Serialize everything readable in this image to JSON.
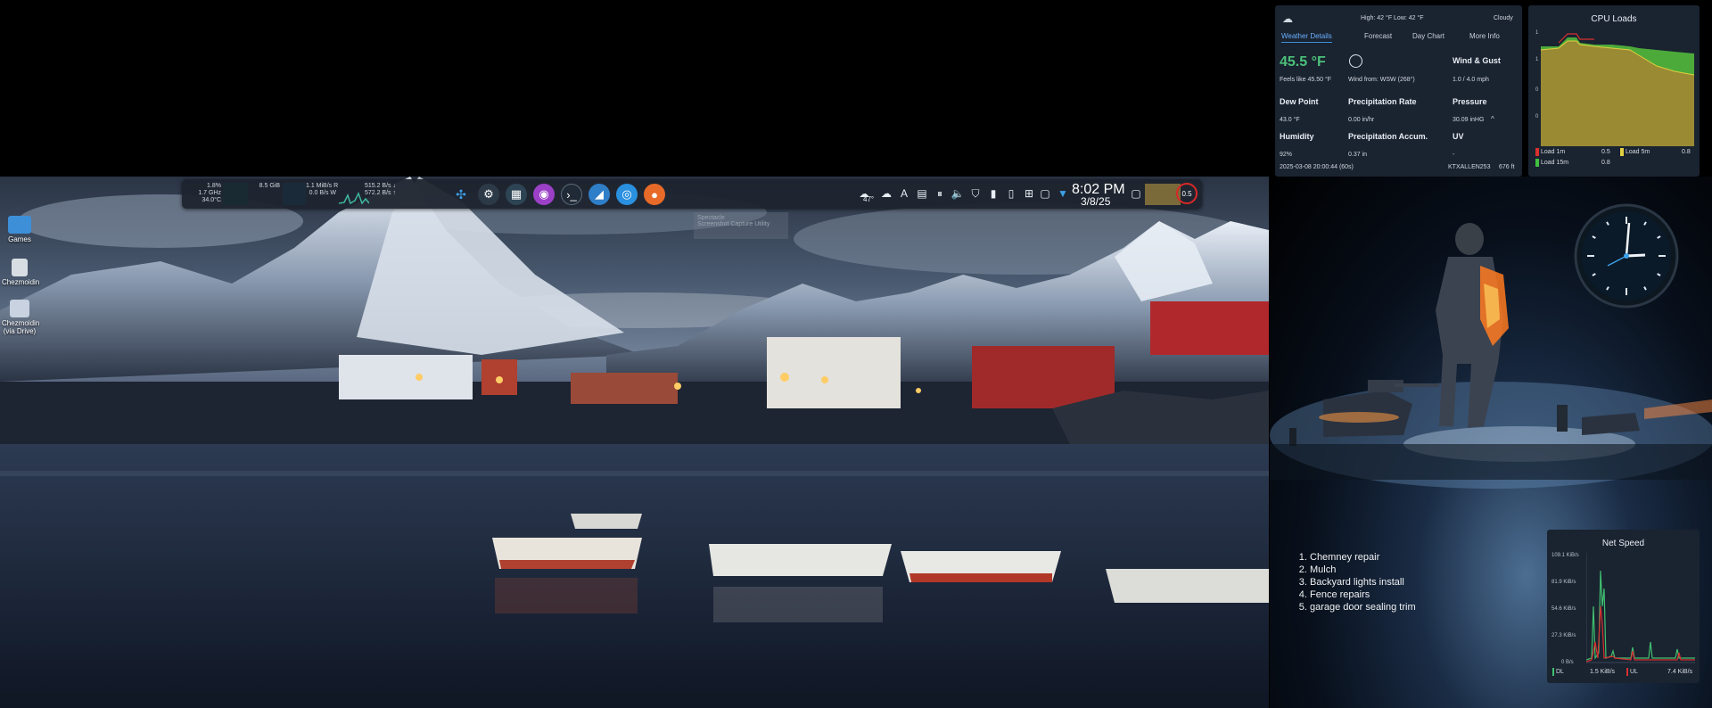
{
  "panel": {
    "sysmon": {
      "cpu_percent": "1.8%",
      "cpu_freq": "1.7 GHz",
      "cpu_temp": "34.0°C",
      "mem": "8.5 GiB",
      "disk_read": "1.1 MiB/s  R",
      "disk_write": "0.0 B/s  W",
      "net_down": "515.2 B/s ↓",
      "net_up": "572.2 B/s ↑"
    },
    "launchers": [
      "kde-logo-icon",
      "system-settings-icon",
      "discover-icon",
      "spectacle-icon",
      "konsole-icon",
      "dolphin-icon",
      "browser-icon",
      "firefox-icon"
    ],
    "tray": {
      "weather_temp": "47°",
      "clock_time": "8:02 PM",
      "clock_date": "3/8/25",
      "load_badge": "0.5"
    },
    "tooltip": {
      "line1": "Spectacle",
      "line2": "Screenshot Capture Utility"
    }
  },
  "desktop_icons": [
    {
      "label": "Games"
    },
    {
      "label": "Chezmoidin"
    },
    {
      "label": "Chezmoidin (via Drive)"
    }
  ],
  "weather": {
    "summary": "High: 42 °F  Low: 42 °F",
    "condition": "Cloudy",
    "tabs": [
      "Weather Details",
      "Forecast",
      "Day Chart",
      "More Info"
    ],
    "temperature": "45.5 °F",
    "wind_title": "Wind & Gust",
    "feels_like": "Feels like 45.50 °F",
    "wind_from": "Wind from: WSW (268°)",
    "wind_value": "1.0 / 4.0 mph",
    "dew_title": "Dew Point",
    "precip_rate_title": "Precipitation Rate",
    "pressure_title": "Pressure",
    "dew_value": "43.0 °F",
    "precip_rate_value": "0.00 in/hr",
    "pressure_value": "30.09 inHG",
    "humidity_title": "Humidity",
    "precip_accum_title": "Precipitation Accum.",
    "uv_title": "UV",
    "humidity_value": "92%",
    "precip_accum_value": "0.37 in",
    "uv_value": "-",
    "timestamp": "2025-03-08 20:00:44 (60s)",
    "station": "KTXALLEN253",
    "elevation": "676 ft"
  },
  "cpu_loads": {
    "title": "CPU Loads",
    "y_ticks": [
      "1",
      "1",
      "0",
      "0"
    ],
    "legend": [
      {
        "label": "Load  1m",
        "value": "0.5",
        "color": "#d83030"
      },
      {
        "label": "Load 5m",
        "value": "0.8",
        "color": "#e0d040"
      },
      {
        "label": "Load 15m",
        "value": "0.8",
        "color": "#40c040"
      }
    ]
  },
  "todo": {
    "items": [
      "Chemney repair",
      "Mulch",
      "Backyard lights install",
      "Fence repairs",
      "garage door sealing trim"
    ]
  },
  "net_speed": {
    "title": "Net Speed",
    "y_ticks": [
      "109.1 KiB/s",
      "81.9 KiB/s",
      "54.6 KiB/s",
      "27.3 KiB/s",
      "0 B/s"
    ],
    "dl_label": "DL",
    "dl_value": "1.5 KiB/s",
    "ul_label": "UL",
    "ul_value": "7.4 KiB/s"
  }
}
